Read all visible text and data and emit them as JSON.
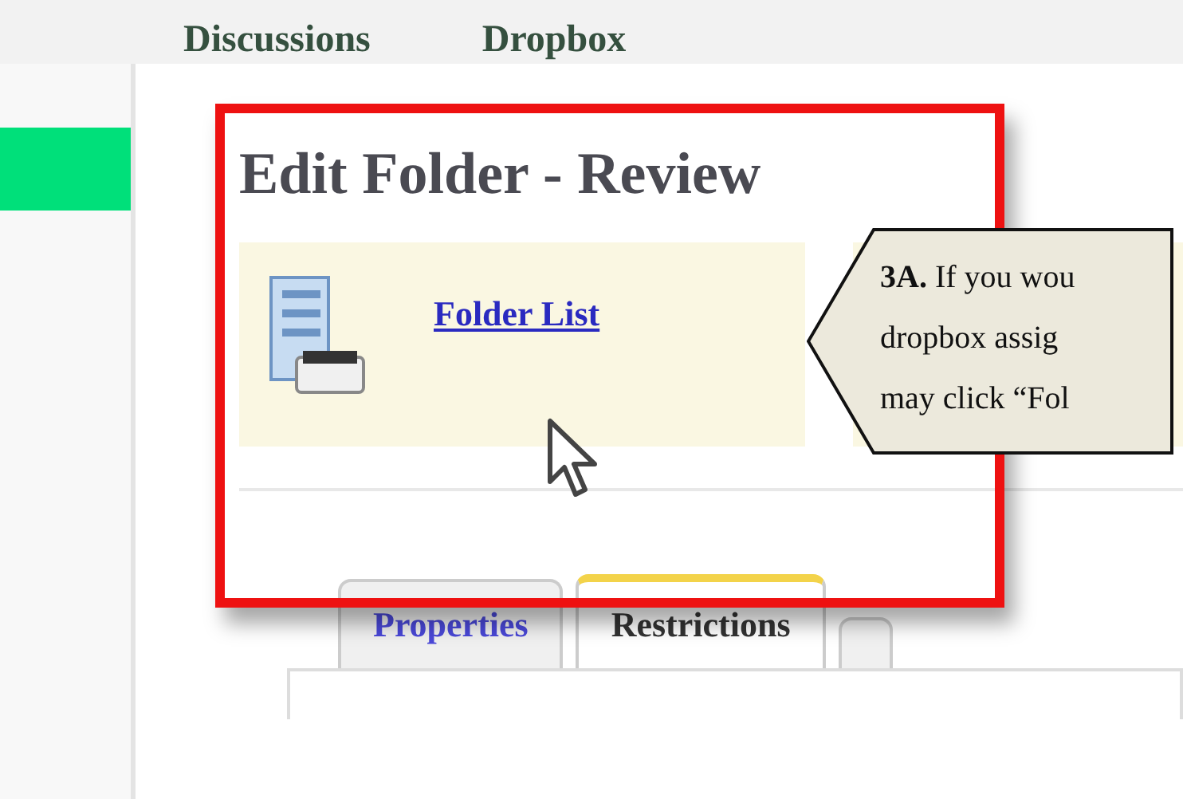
{
  "top_nav": {
    "items": [
      "Discussions",
      "Dropbox"
    ]
  },
  "heading": "Edit Folder - Review",
  "toolbar": {
    "link": "Folder List"
  },
  "callout": {
    "lines": [
      "**3A.** If you wou",
      "dropbox assig",
      "may click “Fol"
    ]
  },
  "tabs": [
    {
      "label": "Properties",
      "selected": false
    },
    {
      "label": "Restrictions",
      "selected": true
    }
  ]
}
